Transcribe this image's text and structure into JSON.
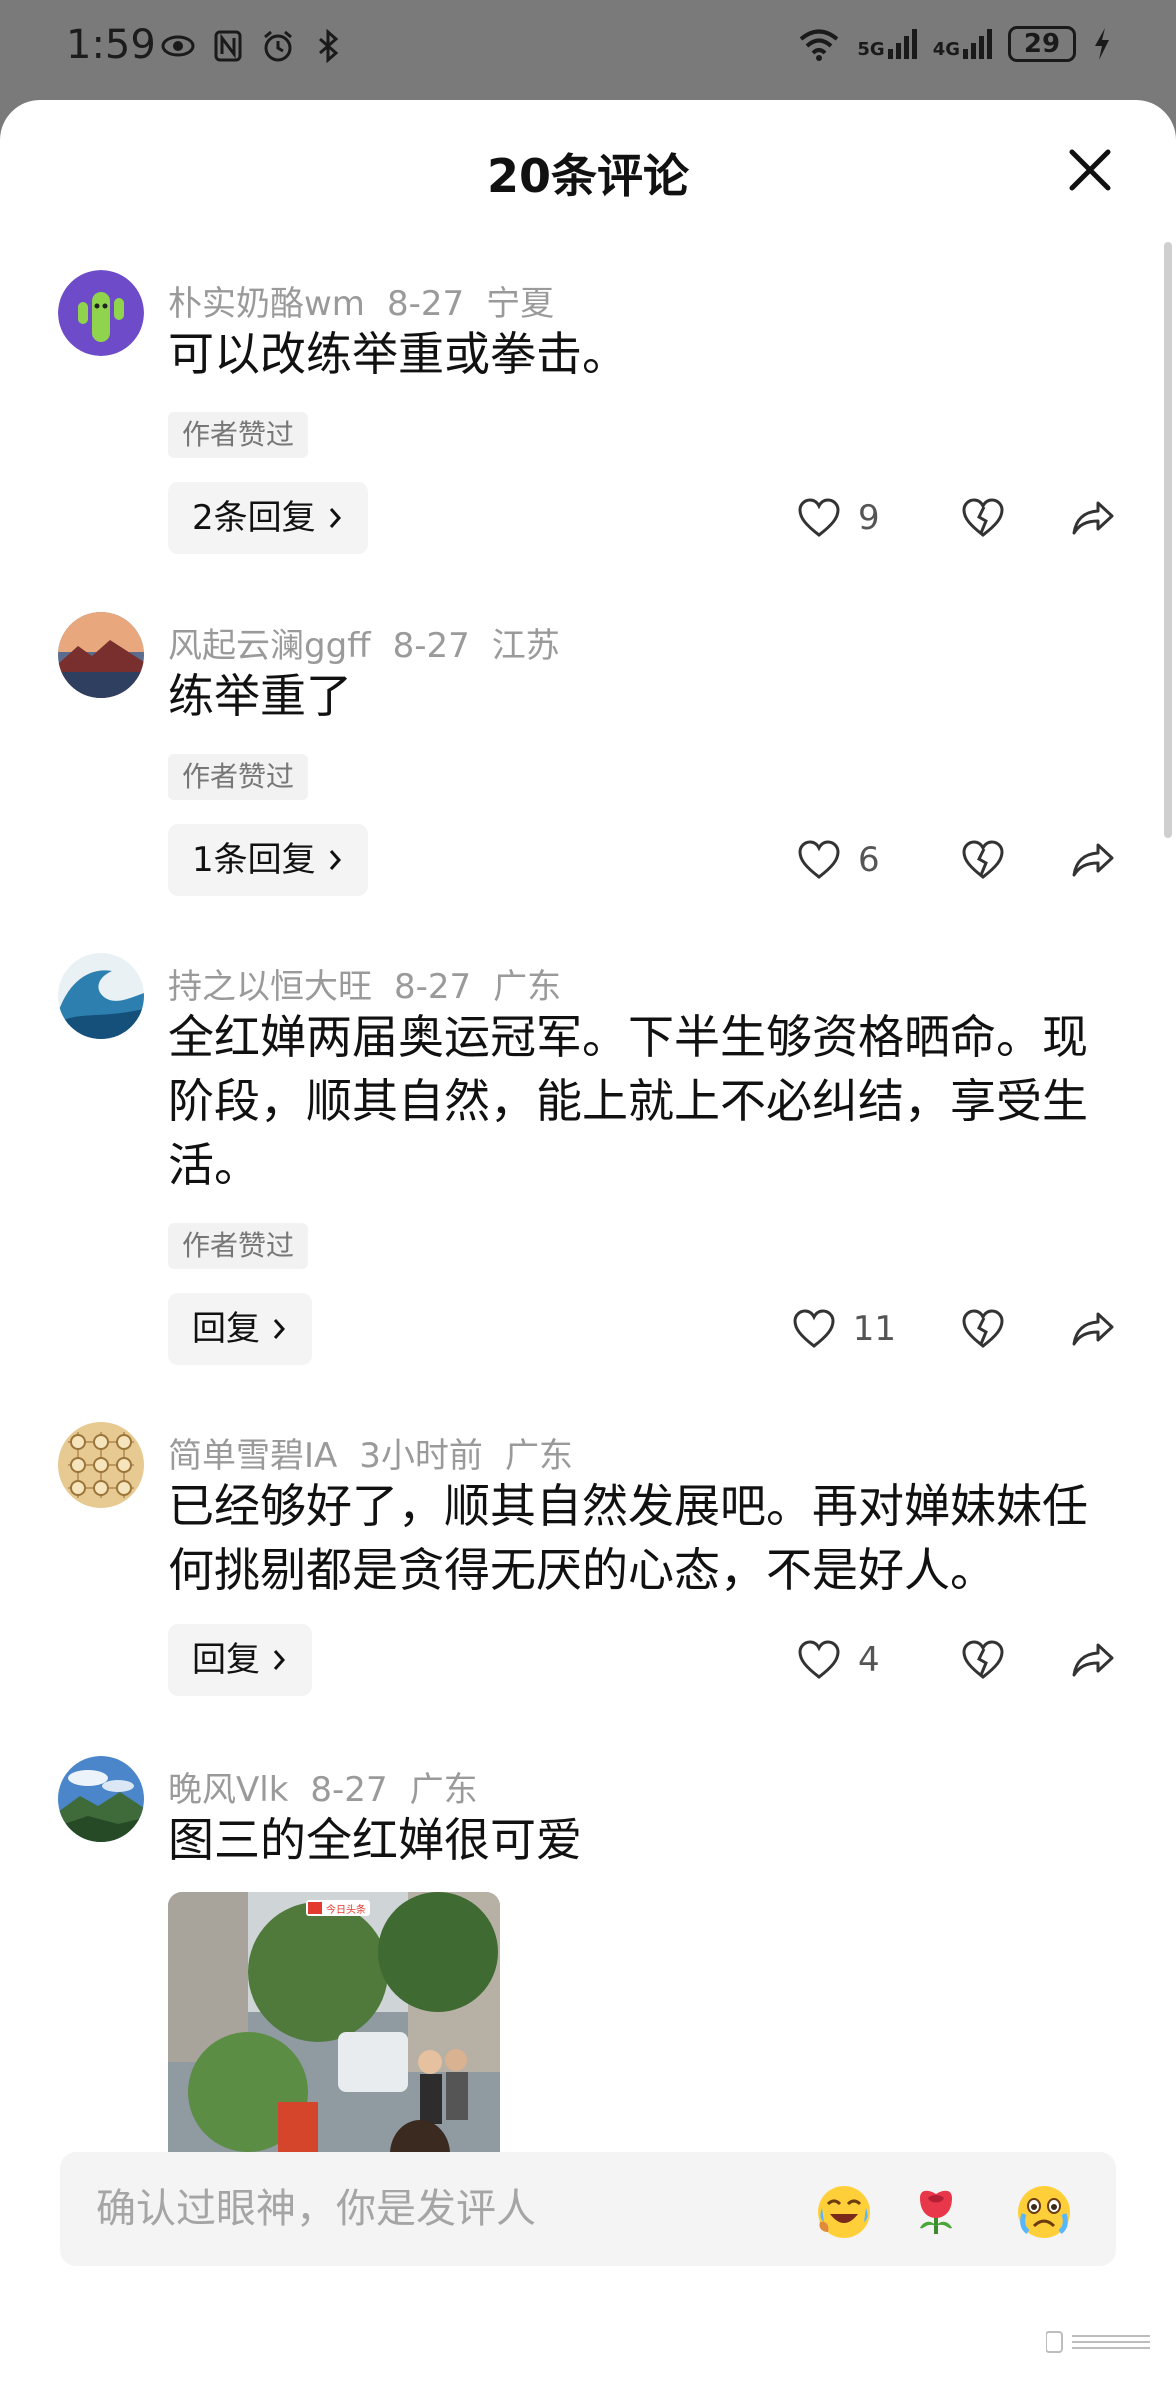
{
  "status_bar": {
    "time": "1:59",
    "signal_1": "5G",
    "signal_2": "4G",
    "battery": "29"
  },
  "sheet": {
    "title": "20条评论"
  },
  "comments": [
    {
      "user": "朴实奶酪wm",
      "date": "8-27",
      "location": "宁夏",
      "text": "可以改练举重或拳击。",
      "badge": "作者赞过",
      "reply_label": "2条回复",
      "likes": "9",
      "avatar": "cactus-avatar"
    },
    {
      "user": "风起云澜ggff",
      "date": "8-27",
      "location": "江苏",
      "text": "练举重了",
      "badge": "作者赞过",
      "reply_label": "1条回复",
      "likes": "6",
      "avatar": "landscape-avatar"
    },
    {
      "user": "持之以恒大旺",
      "date": "8-27",
      "location": "广东",
      "text": "全红婵两届奥运冠军。下半生够资格晒命。现阶段，顺其自然，能上就上不必纠结，享受生活。",
      "badge": "作者赞过",
      "reply_label": "回复",
      "likes": "11",
      "avatar": "wave-avatar"
    },
    {
      "user": "简单雪碧IA",
      "date": "3小时前",
      "location": "广东",
      "text": "已经够好了，顺其自然发展吧。再对婵妹妹任何挑剔都是贪得无厌的心态，不是好人。",
      "reply_label": "回复",
      "likes": "4",
      "avatar": "chess-avatar"
    },
    {
      "user": "晚风Vlk",
      "date": "8-27",
      "location": "广东",
      "text": "图三的全红婵很可爱",
      "avatar": "mountain-avatar",
      "image_label": "今日头条"
    }
  ],
  "input": {
    "placeholder": "确认过眼神，你是发评人"
  },
  "colors": {
    "accent_text": "#111111",
    "meta_text": "#9a9a9a",
    "badge_bg": "#f2f2f2"
  }
}
